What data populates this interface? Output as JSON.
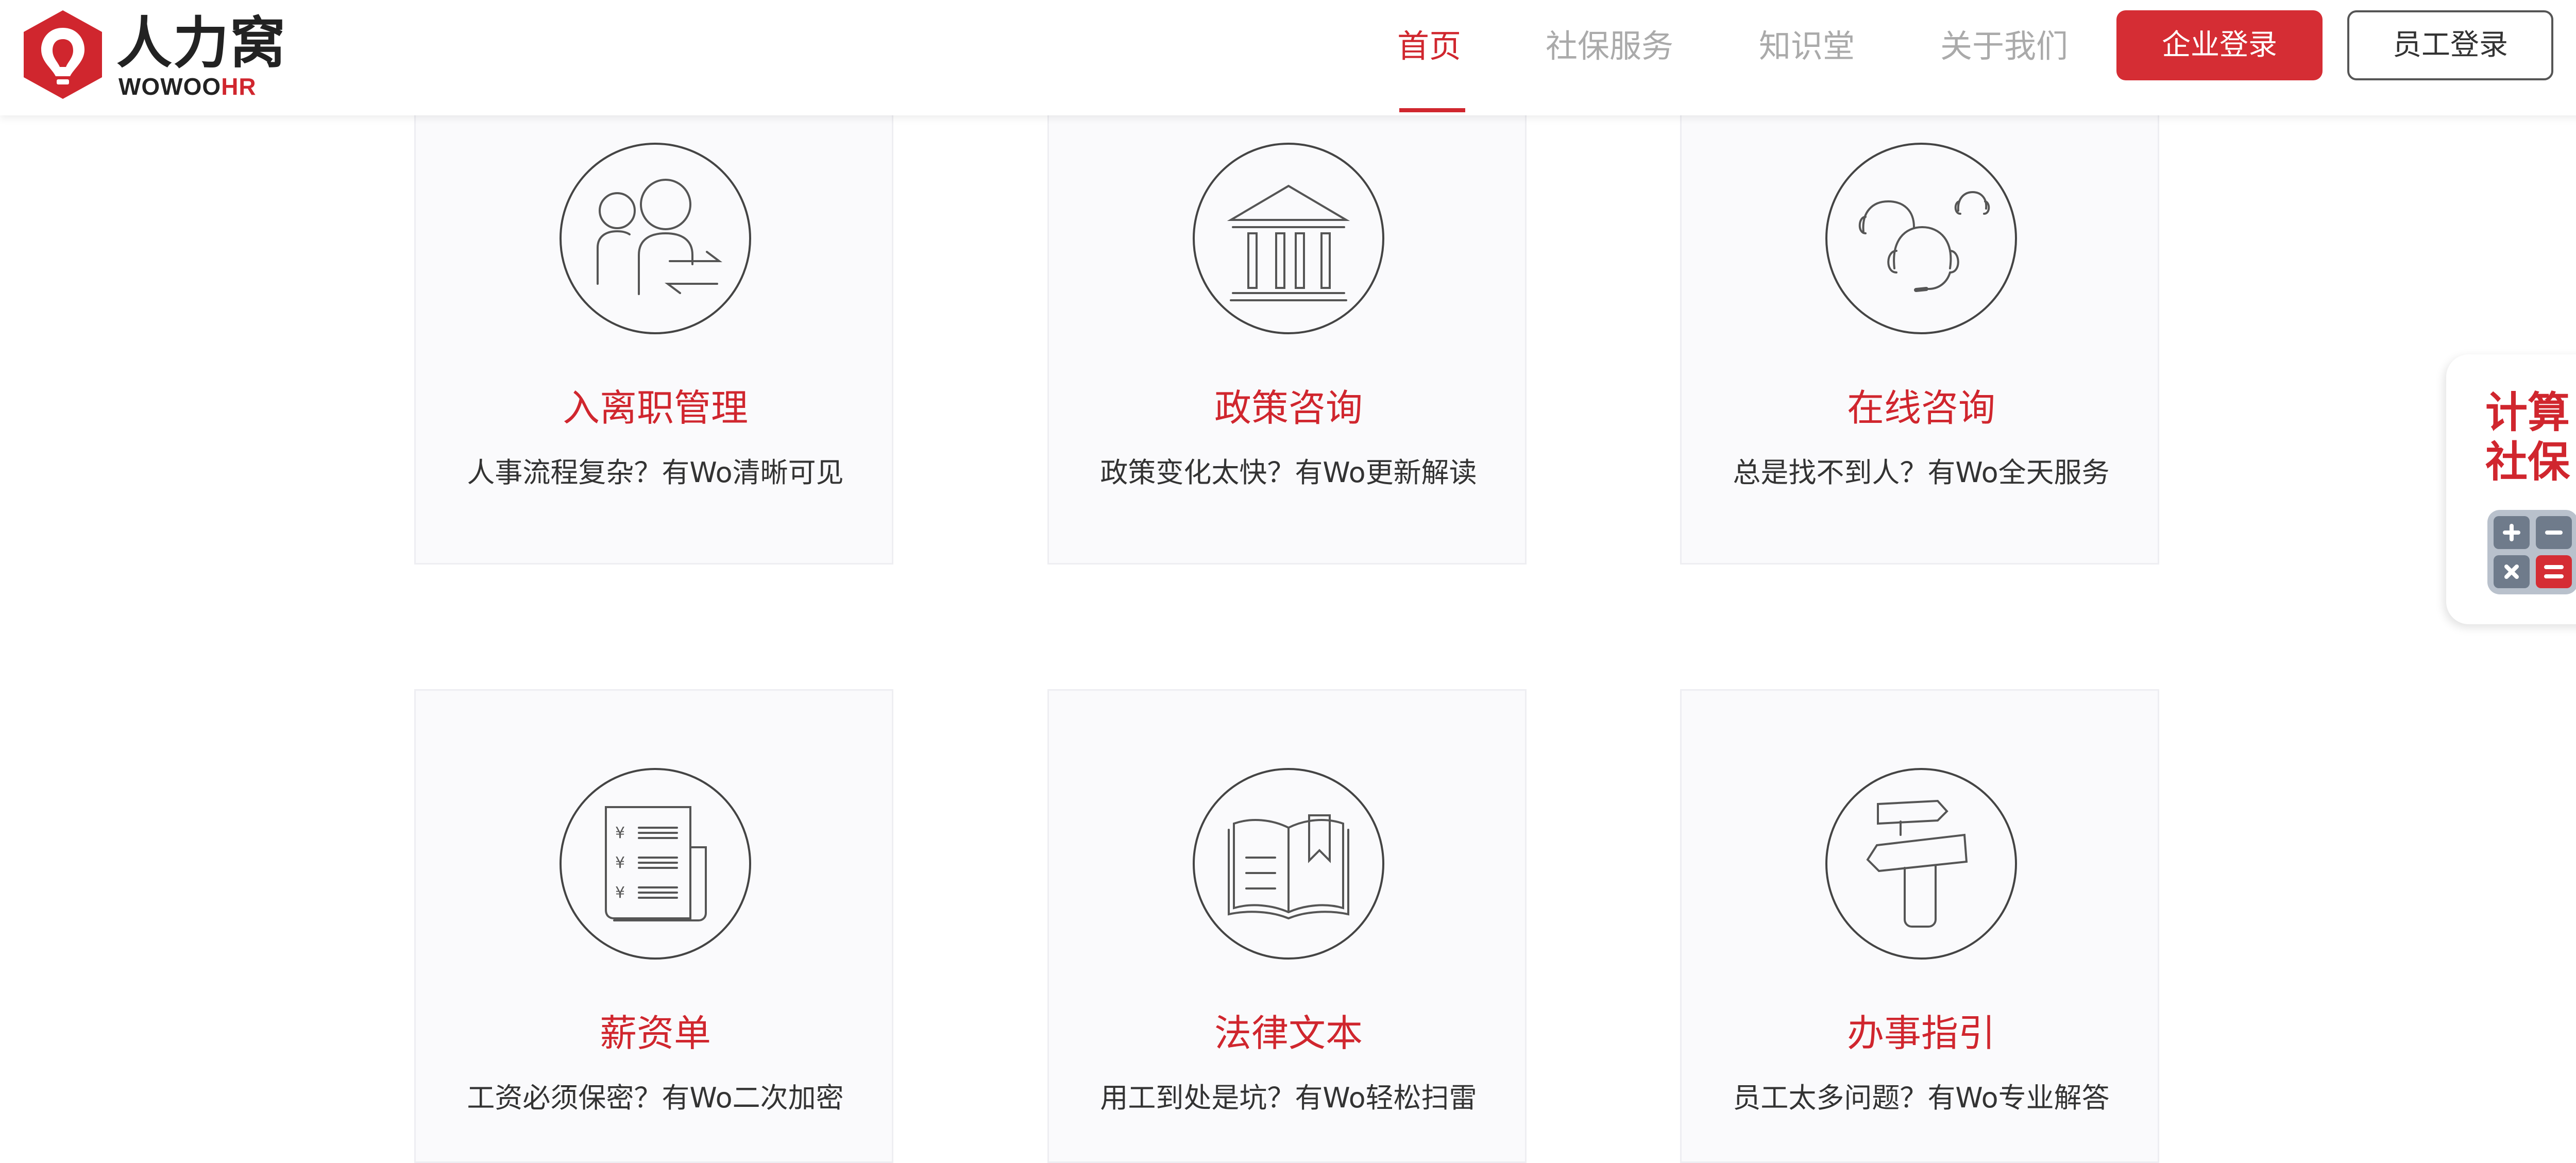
{
  "brand": {
    "logo_text_cn": "人力窝",
    "logo_text_en": "WOWOO",
    "logo_text_en_accent": "HR",
    "accent_color": "#d0262e"
  },
  "nav": {
    "items": [
      {
        "label": "首页",
        "active": true
      },
      {
        "label": "社保服务",
        "active": false
      },
      {
        "label": "知识堂",
        "active": false
      },
      {
        "label": "关于我们",
        "active": false
      }
    ],
    "enterprise_login": "企业登录",
    "employee_login": "员工登录"
  },
  "cards": [
    {
      "icon": "employee-transfer-icon",
      "title": "入离职管理",
      "desc": "人事流程复杂？有Wo清晰可见"
    },
    {
      "icon": "government-building-icon",
      "title": "政策咨询",
      "desc": "政策变化太快？有Wo更新解读"
    },
    {
      "icon": "customer-service-headset-icon",
      "title": "在线咨询",
      "desc": "总是找不到人？有Wo全天服务"
    },
    {
      "icon": "payslip-icon",
      "title": "薪资单",
      "desc": "工资必须保密？有Wo二次加密"
    },
    {
      "icon": "law-book-icon",
      "title": "法律文本",
      "desc": "用工到处是坑？有Wo轻松扫雷"
    },
    {
      "icon": "signpost-icon",
      "title": "办事指引",
      "desc": "员工太多问题？有Wo专业解答"
    }
  ],
  "side_widget": {
    "line1": "计算",
    "line2": "社保",
    "icon": "calculator-icon"
  }
}
